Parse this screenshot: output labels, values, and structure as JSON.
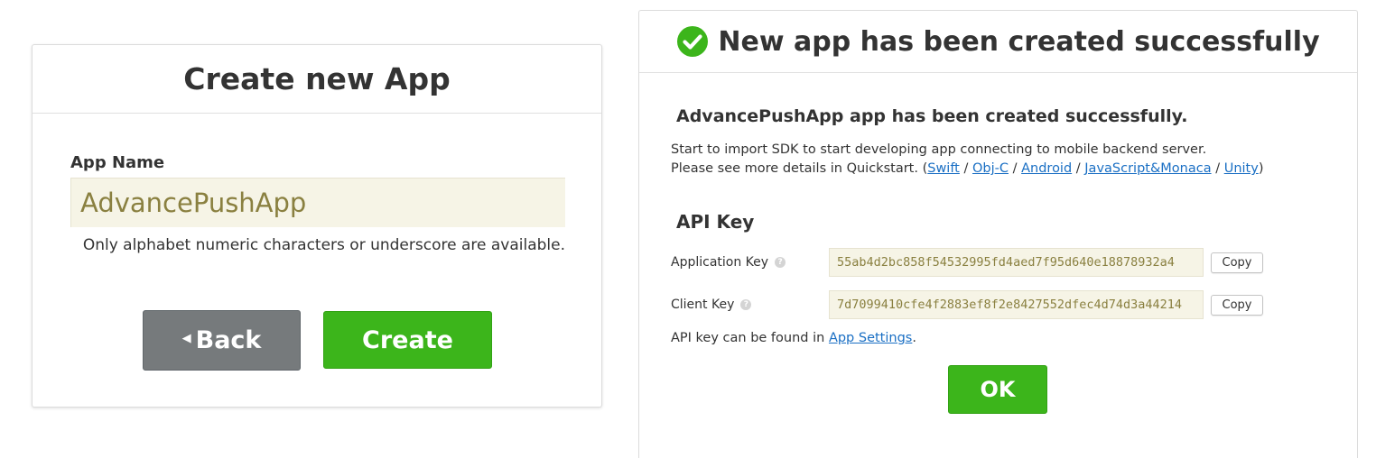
{
  "create_dialog": {
    "title": "Create new App",
    "app_name_label": "App Name",
    "app_name_value": "AdvancePushApp",
    "hint": "Only alphabet numeric characters or underscore are available.",
    "back_label": "Back",
    "create_label": "Create"
  },
  "success_dialog": {
    "title": "New app has been created successfully",
    "subtitle": "AdvancePushApp app has been created successfully.",
    "desc_line1": "Start to import SDK to start developing app connecting to mobile backend server.",
    "desc_line2_prefix": "Please see more details in Quickstart. (",
    "desc_line2_suffix": ")",
    "separator": "/",
    "quickstart_links": [
      "Swift",
      "Obj-C",
      "Android",
      "JavaScript&Monaca",
      "Unity"
    ],
    "api_key_heading": "API Key",
    "application_key_label": "Application Key",
    "application_key_value": "55ab4d2bc858f54532995fd4aed7f95d640e18878932a4",
    "client_key_label": "Client Key",
    "client_key_value": "7d7099410cfe4f2883ef8f2e8427552dfec4d74d3a44214",
    "help_glyph": "?",
    "copy_label": "Copy",
    "note_prefix": "API key can be found in ",
    "note_link": "App Settings",
    "note_suffix": ".",
    "ok_label": "OK"
  },
  "colors": {
    "accent_green": "#3cb51b",
    "back_gray": "#767a7c",
    "link_blue": "#1a6fc4",
    "input_bg": "#f6f4e6",
    "input_text": "#8a8040"
  }
}
